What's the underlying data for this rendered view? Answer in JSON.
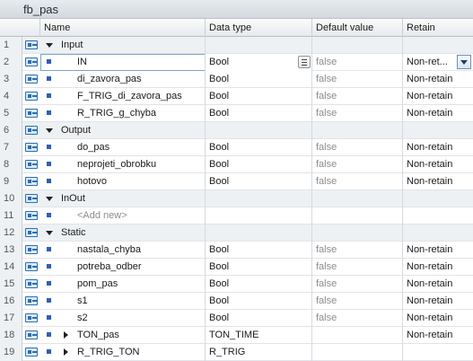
{
  "window": {
    "title": "fb_pas"
  },
  "columns": {
    "name": "Name",
    "data_type": "Data type",
    "default_value": "Default value",
    "retain": "Retain"
  },
  "rows": [
    {
      "num": "1",
      "kind": "section",
      "name": "Input",
      "type": "",
      "default": "",
      "retain": ""
    },
    {
      "num": "2",
      "kind": "var",
      "name": "IN",
      "type": "Bool",
      "default": "false",
      "retain": "Non-ret...",
      "selected": true
    },
    {
      "num": "3",
      "kind": "var",
      "name": "di_zavora_pas",
      "type": "Bool",
      "default": "false",
      "retain": "Non-retain"
    },
    {
      "num": "4",
      "kind": "var",
      "name": "F_TRIG_di_zavora_pas",
      "type": "Bool",
      "default": "false",
      "retain": "Non-retain"
    },
    {
      "num": "5",
      "kind": "var",
      "name": "R_TRIG_g_chyba",
      "type": "Bool",
      "default": "false",
      "retain": "Non-retain"
    },
    {
      "num": "6",
      "kind": "section",
      "name": "Output",
      "type": "",
      "default": "",
      "retain": ""
    },
    {
      "num": "7",
      "kind": "var",
      "name": "do_pas",
      "type": "Bool",
      "default": "false",
      "retain": "Non-retain"
    },
    {
      "num": "8",
      "kind": "var",
      "name": "neprojeti_obrobku",
      "type": "Bool",
      "default": "false",
      "retain": "Non-retain"
    },
    {
      "num": "9",
      "kind": "var",
      "name": "hotovo",
      "type": "Bool",
      "default": "false",
      "retain": "Non-retain"
    },
    {
      "num": "10",
      "kind": "section",
      "name": "InOut",
      "type": "",
      "default": "",
      "retain": ""
    },
    {
      "num": "11",
      "kind": "addnew",
      "name": "<Add new>",
      "type": "",
      "default": "",
      "retain": ""
    },
    {
      "num": "12",
      "kind": "section",
      "name": "Static",
      "type": "",
      "default": "",
      "retain": ""
    },
    {
      "num": "13",
      "kind": "var",
      "name": "nastala_chyba",
      "type": "Bool",
      "default": "false",
      "retain": "Non-retain"
    },
    {
      "num": "14",
      "kind": "var",
      "name": "potreba_odber",
      "type": "Bool",
      "default": "false",
      "retain": "Non-retain"
    },
    {
      "num": "15",
      "kind": "var",
      "name": "pom_pas",
      "type": "Bool",
      "default": "false",
      "retain": "Non-retain"
    },
    {
      "num": "16",
      "kind": "var",
      "name": "s1",
      "type": "Bool",
      "default": "false",
      "retain": "Non-retain"
    },
    {
      "num": "17",
      "kind": "var",
      "name": "s2",
      "type": "Bool",
      "default": "false",
      "retain": "Non-retain"
    },
    {
      "num": "18",
      "kind": "instance",
      "name": "TON_pas",
      "type": "TON_TIME",
      "default": "",
      "retain": "Non-retain"
    },
    {
      "num": "19",
      "kind": "instance",
      "name": "R_TRIG_TON",
      "type": "R_TRIG",
      "default": "",
      "retain": ""
    }
  ]
}
